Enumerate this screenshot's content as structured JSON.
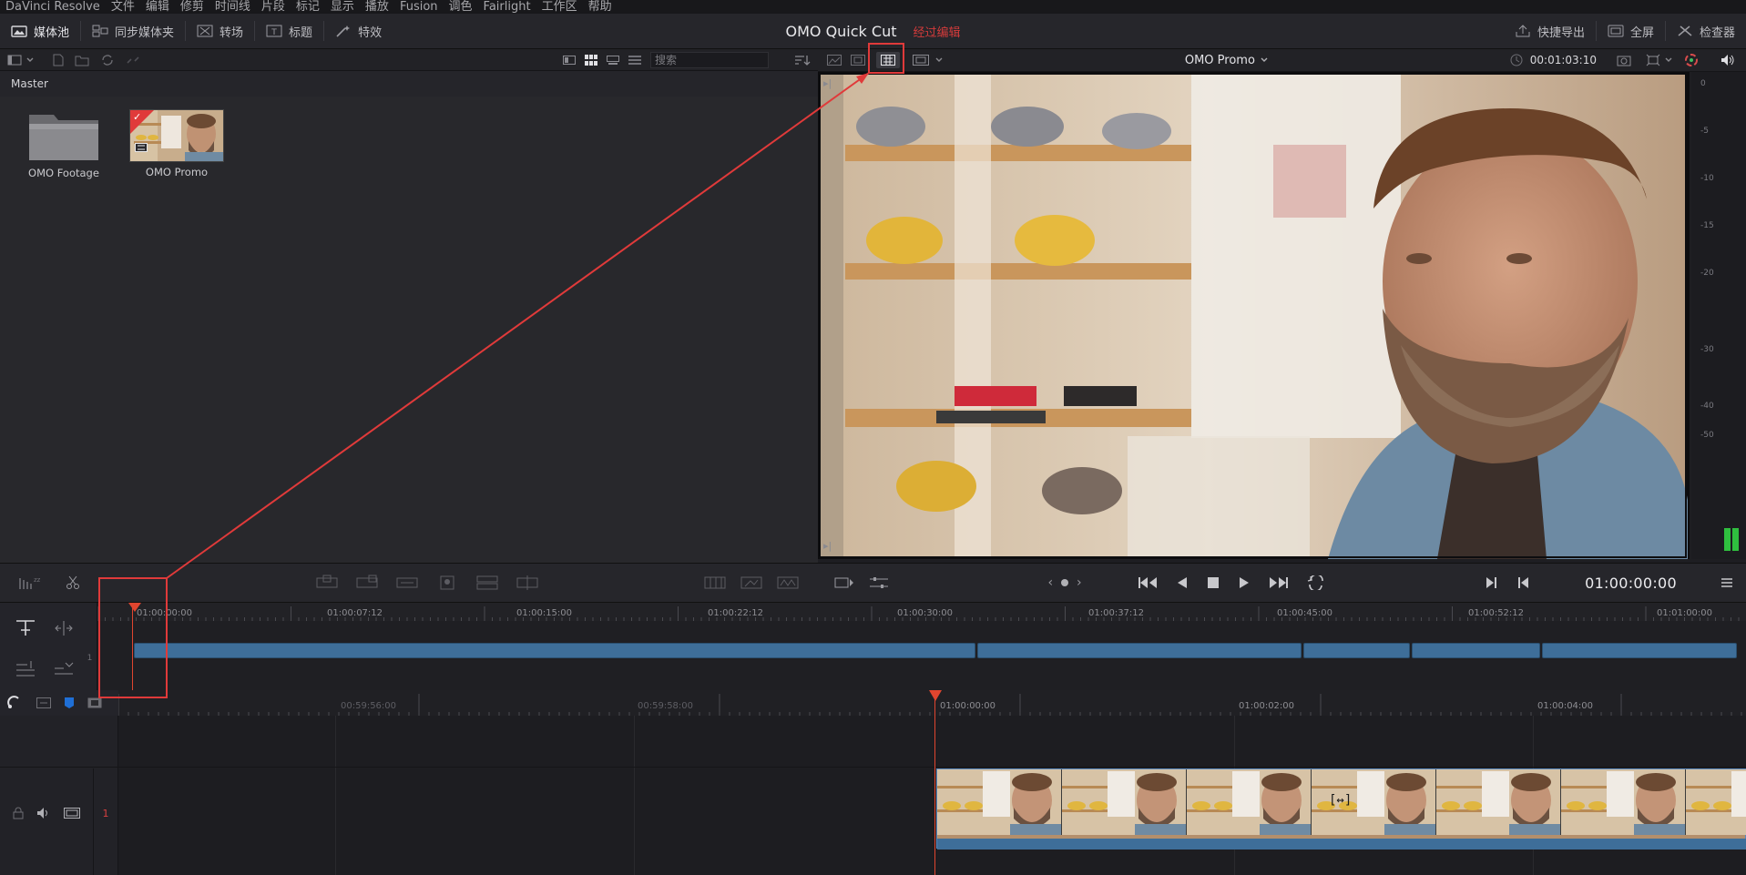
{
  "menu": [
    "DaVinci Resolve",
    "文件",
    "编辑",
    "修剪",
    "时间线",
    "片段",
    "标记",
    "显示",
    "播放",
    "Fusion",
    "调色",
    "Fairlight",
    "工作区",
    "帮助"
  ],
  "toolbar": {
    "media_pool": "媒体池",
    "sync_bin": "同步媒体夹",
    "transitions": "转场",
    "titles": "标题",
    "effects": "特效",
    "quick_export": "快捷导出",
    "fullscreen": "全屏",
    "inspector": "检查器"
  },
  "project": {
    "name": "OMO Quick Cut",
    "status": "经过编辑"
  },
  "media_pool": {
    "search_placeholder": "搜索",
    "breadcrumb": "Master",
    "items": [
      {
        "label": "OMO Footage",
        "kind": "folder"
      },
      {
        "label": "OMO Promo",
        "kind": "timeline"
      }
    ]
  },
  "viewer": {
    "timeline_name": "OMO Promo",
    "duration": "00:01:03:10",
    "current_timecode": "01:00:00:00"
  },
  "audio_meter": {
    "ticks": [
      "0",
      "-5",
      "-10",
      "-15",
      "-20",
      "-30",
      "-40",
      "-50"
    ],
    "level_fraction": 0.08
  },
  "upper_timeline": {
    "ruler": [
      "01:00:00:00",
      "01:00:07:12",
      "01:00:15:00",
      "01:00:22:12",
      "01:00:30:00",
      "01:00:37:12",
      "01:00:45:00",
      "01:00:52:12",
      "01:01:00:00"
    ],
    "track_label": "1"
  },
  "lower_timeline": {
    "ruler": [
      "00:59:56:00",
      "00:59:58:00",
      "01:00:00:00",
      "01:00:02:00",
      "01:00:04:00"
    ],
    "track_label": "1"
  },
  "colors": {
    "accent_red": "#e03a3a",
    "clip_blue": "#3e6e99",
    "playhead": "#e0452f",
    "meter_green": "#2fbf3f"
  }
}
